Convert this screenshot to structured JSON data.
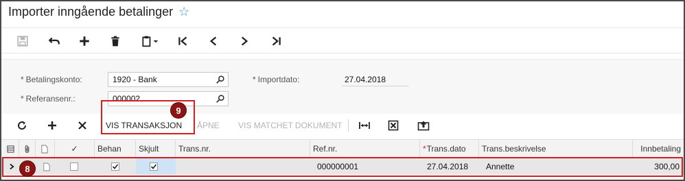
{
  "page": {
    "title": "Importer inngående betalinger",
    "star_icon": "★"
  },
  "toolbar": {
    "save": "save-icon",
    "undo": "undo-icon",
    "add": "add-icon",
    "delete": "delete-icon",
    "clipboard": "clipboard-icon",
    "first": "first-record-icon",
    "prev": "previous-record-icon",
    "next": "next-record-icon",
    "last": "last-record-icon"
  },
  "form": {
    "betalingskonto_label": "Betalingskonto:",
    "betalingskonto_value": "1920 - Bank",
    "referansenr_label": "Referansenr.:",
    "referansenr_value": "000002",
    "importdato_label": "Importdato:",
    "importdato_value": "27.04.2018",
    "required_mark": "*"
  },
  "grid_toolbar": {
    "vis_transaksjon": "VIS TRANSAKSJON",
    "apne": "ÅPNE",
    "vis_matchet_dokument": "VIS MATCHET DOKUMENT"
  },
  "grid": {
    "columns": {
      "behan": "Behan",
      "skjult": "Skjult",
      "trans_nr": "Trans.nr.",
      "ref_nr": "Ref.nr.",
      "trans_dato": "Trans.dato",
      "trans_beskrivelse": "Trans.beskrivelse",
      "innbetaling": "Innbetaling",
      "check_header": "✓"
    },
    "rows": [
      {
        "trans_nr": "",
        "ref_nr": "000000001",
        "trans_dato": "27.04.2018",
        "trans_beskrivelse": "Annette",
        "innbetaling": "300,00",
        "behan": true,
        "skjult": true
      }
    ]
  },
  "callouts": {
    "badge_9": "9",
    "badge_8": "8",
    "color": "#d11f1f"
  }
}
